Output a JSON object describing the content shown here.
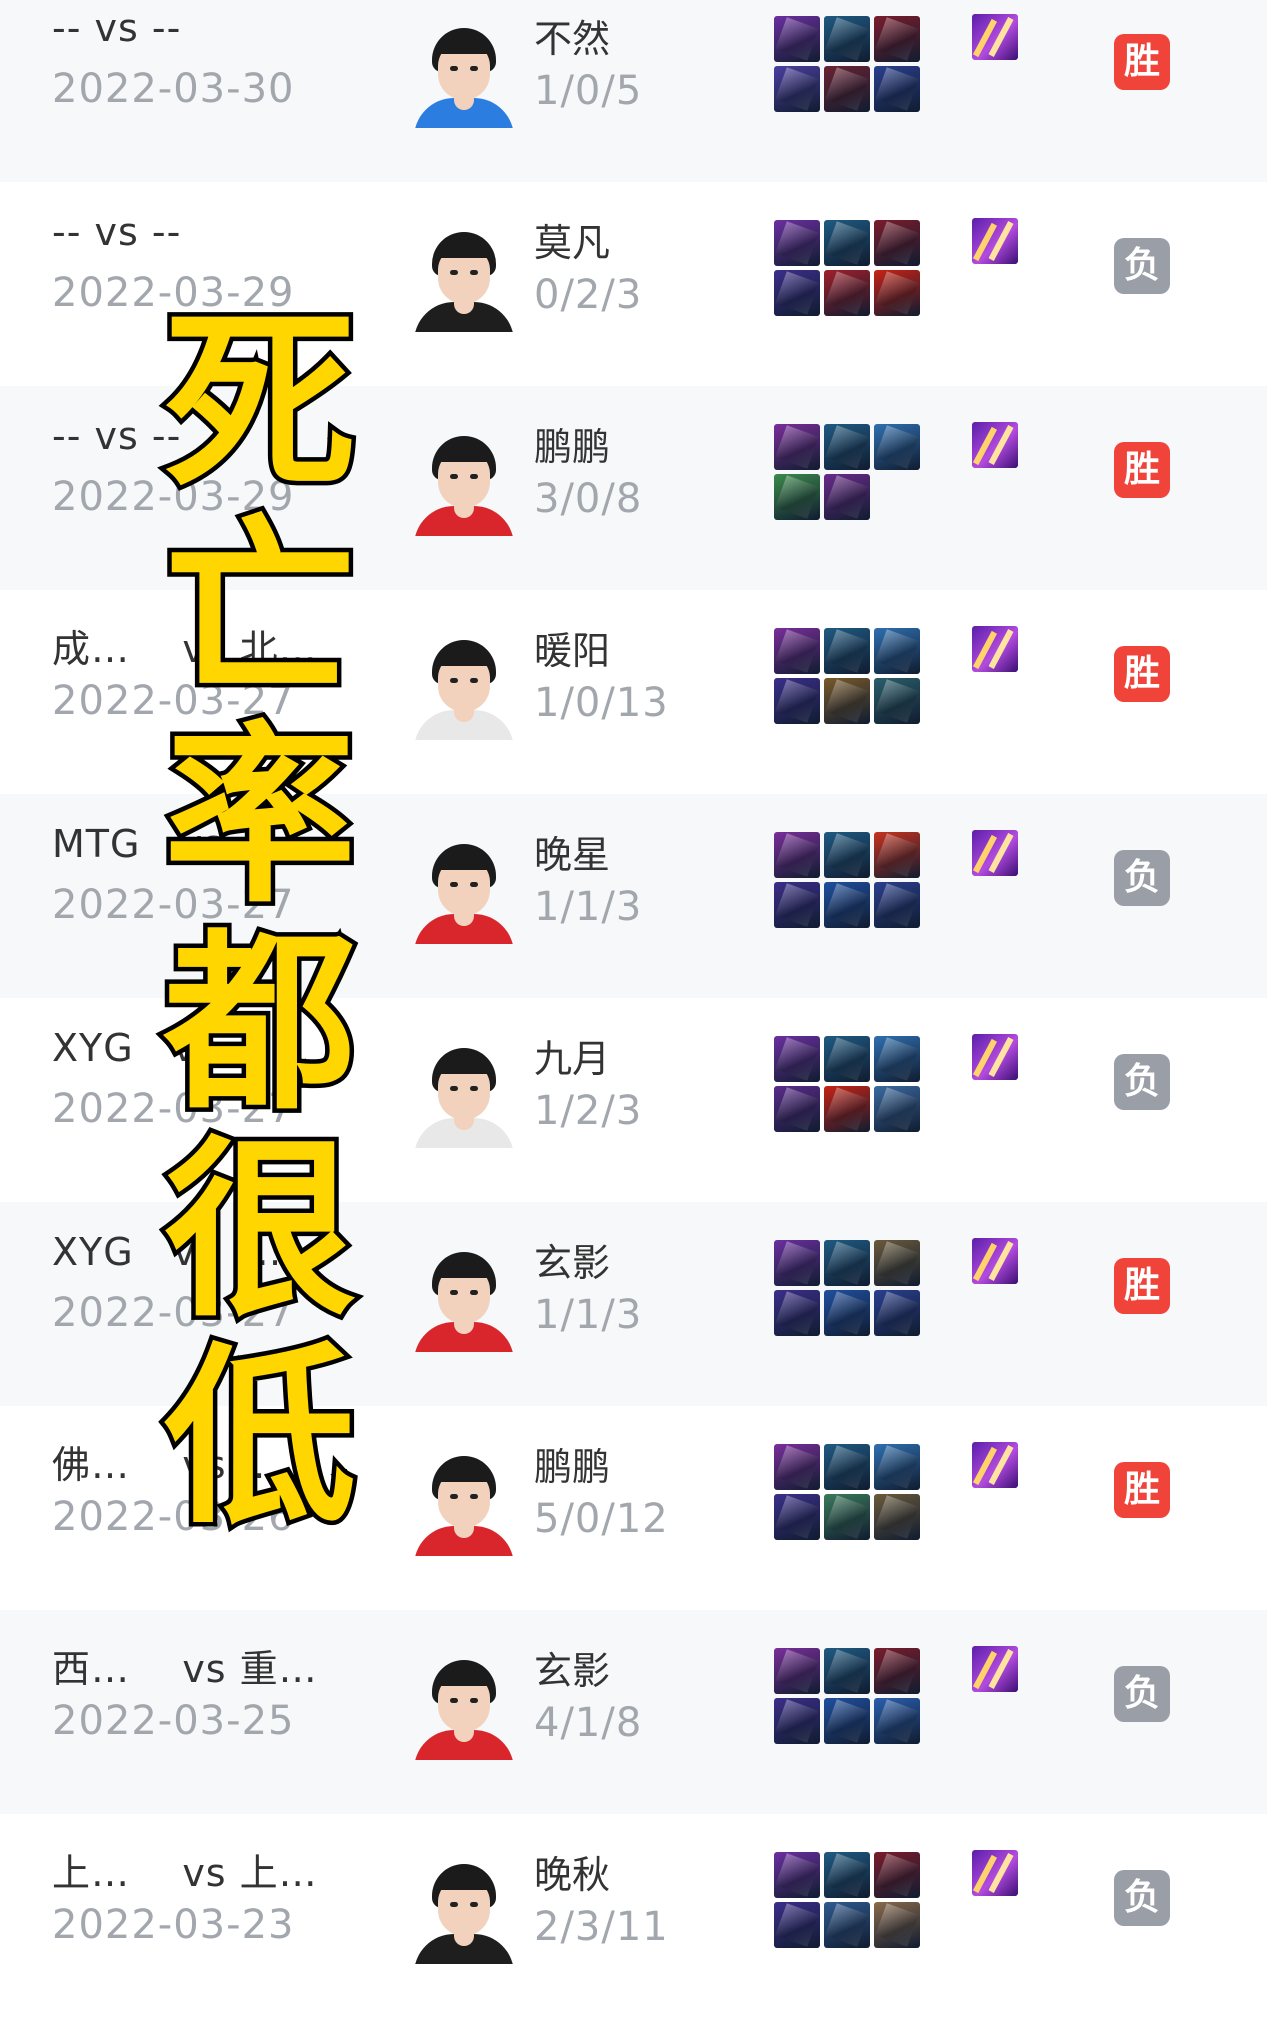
{
  "colors": {
    "win": "#f0443a",
    "loss": "#9a9ea6",
    "overlay_fill": "#ffd600",
    "overlay_stroke": "#000000"
  },
  "overlay_text": [
    "死",
    "亡",
    "率",
    "都",
    "很",
    "低"
  ],
  "matches": [
    {
      "title": "-- vs --",
      "date": "2022-03-30",
      "player": "不然",
      "kda": "1/0/5",
      "result": "胜",
      "result_type": "win",
      "jersey": "#2b7de0",
      "items": [
        "#6b2fa0",
        "#1f5a82",
        "#7a1c2c",
        "#4b3ea0",
        "#6a2232",
        "#2a3f8f"
      ]
    },
    {
      "title": "-- vs --",
      "date": "2022-03-29",
      "player": "莫凡",
      "kda": "0/2/3",
      "result": "负",
      "result_type": "loss",
      "jersey": "#1e1e1e",
      "items": [
        "#6b2fa0",
        "#1f5a82",
        "#7a1c2c",
        "#3b2e8a",
        "#a01e2a",
        "#c82214"
      ]
    },
    {
      "title": "-- vs --",
      "date": "2022-03-29",
      "player": "鹏鹏",
      "kda": "3/0/8",
      "result": "胜",
      "result_type": "win",
      "jersey": "#d9262c",
      "items": [
        "#7a2e9a",
        "#1f5a82",
        "#2f6fb0",
        "#3a8a4a",
        "#6a2a8a"
      ]
    },
    {
      "title": "成…    vs 北…",
      "date": "2022-03-27",
      "player": "暖阳",
      "kda": "1/0/13",
      "result": "胜",
      "result_type": "win",
      "jersey": "#e8e8e8",
      "items": [
        "#7a2e9a",
        "#1f5a82",
        "#2f6fb0",
        "#3b2e8a",
        "#7a5a2a",
        "#2a5f6a"
      ]
    },
    {
      "title": "MTG   vs  …",
      "date": "2022-03-27",
      "player": "晚星",
      "kda": "1/1/3",
      "result": "负",
      "result_type": "loss",
      "jersey": "#d9262c",
      "items": [
        "#7a2e9a",
        "#1f5a82",
        "#c8321e",
        "#3b2e8a",
        "#1f4fa0",
        "#2a3f8f"
      ]
    },
    {
      "title": "XYG   vs  …",
      "date": "2022-03-27",
      "player": "九月",
      "kda": "1/2/3",
      "result": "负",
      "result_type": "loss",
      "jersey": "#e8e8e8",
      "items": [
        "#6b2fa0",
        "#1f5a82",
        "#2f6fb0",
        "#5a2a8a",
        "#c82214",
        "#3a6aa0"
      ]
    },
    {
      "title": "XYG   vs  …",
      "date": "2022-03-27",
      "player": "玄影",
      "kda": "1/1/3",
      "result": "胜",
      "result_type": "win",
      "jersey": "#d9262c",
      "items": [
        "#6b2fa0",
        "#1f5a82",
        "#6a5a3a",
        "#3b2e8a",
        "#1f4fa0",
        "#2a3f8f"
      ]
    },
    {
      "title": "佛…    vs  …",
      "date": "2022-03-26",
      "player": "鹏鹏",
      "kda": "5/0/12",
      "result": "胜",
      "result_type": "win",
      "jersey": "#d9262c",
      "items": [
        "#7a2e9a",
        "#1f5a82",
        "#2f6fb0",
        "#3b2e8a",
        "#3a7a5a",
        "#6a5a3a"
      ]
    },
    {
      "title": "西…    vs 重…",
      "date": "2022-03-25",
      "player": "玄影",
      "kda": "4/1/8",
      "result": "负",
      "result_type": "loss",
      "jersey": "#d9262c",
      "items": [
        "#7a2e9a",
        "#1f5a82",
        "#7a1c2c",
        "#3b2e8a",
        "#1f4fa0",
        "#2a5fb0"
      ]
    },
    {
      "title": "上…    vs 上…",
      "date": "2022-03-23",
      "player": "晚秋",
      "kda": "2/3/11",
      "result": "负",
      "result_type": "loss",
      "jersey": "#1e1e1e",
      "items": [
        "#6b2fa0",
        "#1f5a82",
        "#7a1c2c",
        "#3b2e8a",
        "#2f5a90",
        "#8a6a4a"
      ]
    }
  ]
}
